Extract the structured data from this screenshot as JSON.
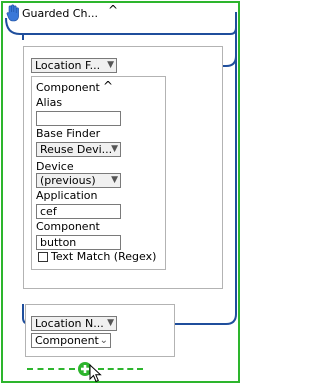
{
  "header": {
    "title": "Guarded Ch...",
    "collapse_icon": "chevron-up-icon",
    "hand_icon": "hand-icon"
  },
  "location_finder": {
    "label": "Location F..."
  },
  "component_panel": {
    "title": "Component",
    "alias_label": "Alias",
    "alias_value": "",
    "base_finder_label": "Base Finder",
    "base_finder_value": "Reuse Devi...",
    "device_label": "Device",
    "device_value": "(previous)",
    "application_label": "Application",
    "application_value": "cef",
    "component_label": "Component",
    "component_value": "button",
    "text_match_label": "Text Match (Regex)"
  },
  "location_n": {
    "label": "Location N...",
    "component_select": "Component"
  },
  "colors": {
    "frame": "#2db52d",
    "wire": "#1f4e9c"
  },
  "add_icon": "plus-circle-icon"
}
